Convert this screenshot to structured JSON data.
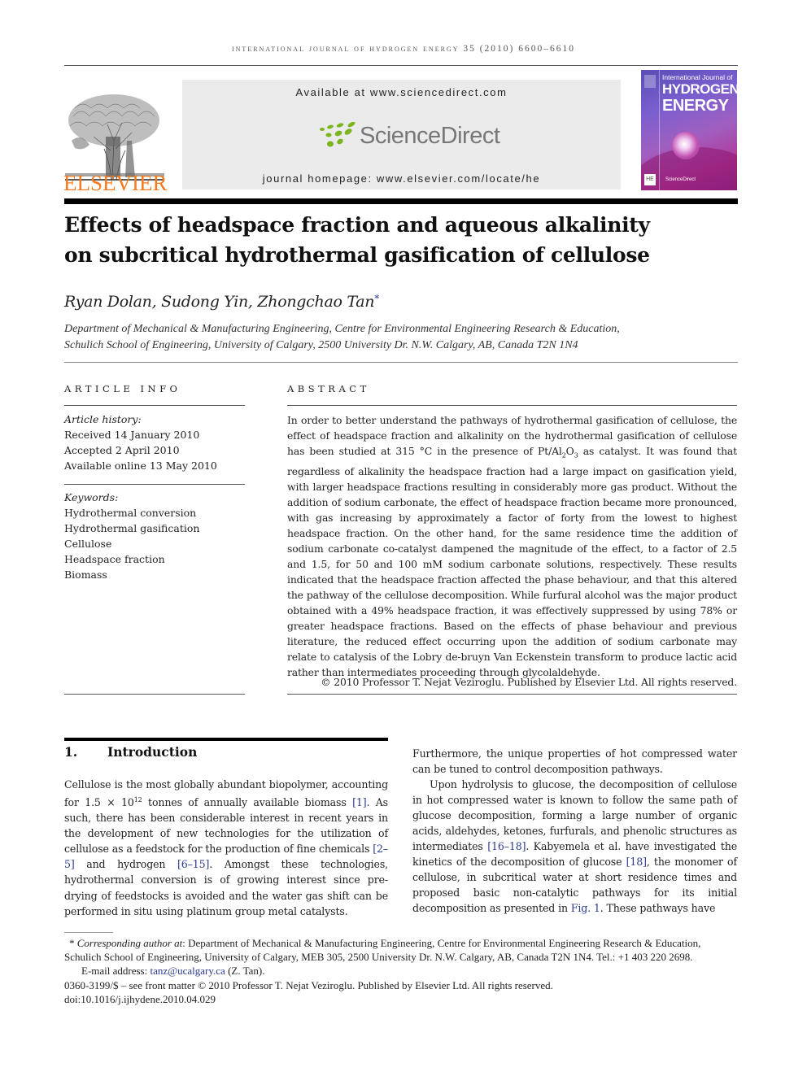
{
  "running_head": "International Journal of Hydrogen Energy 35 (2010) 6600–6610",
  "header": {
    "publisher_logo_text": "ELSEVIER",
    "available_at": "Available at www.sciencedirect.com",
    "sciencedirect_logo_text": "ScienceDirect",
    "journal_homepage": "journal homepage: www.elsevier.com/locate/he",
    "cover": {
      "line1": "International Journal of",
      "line2": "HYDROGEN",
      "line3": "ENERGY",
      "footer": "ScienceDirect",
      "badge": "HE"
    },
    "colors": {
      "elsevier_orange": "#f47b20",
      "sciencedirect_green": "#7ab51d",
      "sciencedirect_gray": "#777777",
      "box_bg": "#ebebeb",
      "link_blue": "#2b3a8f"
    }
  },
  "article": {
    "title_line1": "Effects of headspace fraction and aqueous alkalinity",
    "title_line2": "on subcritical hydrothermal gasification of cellulose",
    "authors": "Ryan Dolan, Sudong Yin, Zhongchao Tan",
    "corresponding_mark": "*",
    "affiliation_line1": "Department of Mechanical & Manufacturing Engineering, Centre for Environmental Engineering Research & Education,",
    "affiliation_line2": "Schulich School of Engineering, University of Calgary, 2500 University Dr. N.W. Calgary, AB, Canada T2N 1N4"
  },
  "article_info": {
    "heading": "ARTICLE INFO",
    "history_label": "Article history:",
    "history": [
      "Received 14 January 2010",
      "Accepted 2 April 2010",
      "Available online 13 May 2010"
    ],
    "keywords_label": "Keywords:",
    "keywords": [
      "Hydrothermal conversion",
      "Hydrothermal gasification",
      "Cellulose",
      "Headspace fraction",
      "Biomass"
    ]
  },
  "abstract": {
    "heading": "ABSTRACT",
    "text_part1": "In order to better understand the pathways of hydrothermal gasification of cellulose, the effect of headspace fraction and alkalinity on the hydrothermal gasification of cellulose has been studied at 315 °C in the presence of Pt/Al",
    "sub1": "2",
    "text_part2": "O",
    "sub2": "3",
    "text_part3": " as catalyst. It was found that regardless of alkalinity the headspace fraction had a large impact on gasification yield, with larger headspace fractions resulting in considerably more gas product. Without the addition of sodium carbonate, the effect of headspace fraction became more pronounced, with gas increasing by approximately a factor of forty from the lowest to highest headspace fraction. On the other hand, for the same residence time the addition of sodium carbonate co-catalyst dampened the magnitude of the effect, to a factor of 2.5 and 1.5, for 50 and 100 mM sodium carbonate solutions, respectively. These results indicated that the headspace fraction affected the phase behaviour, and that this altered the pathway of the cellulose decomposition. While furfural alcohol was the major product obtained with a 49% headspace fraction, it was effectively suppressed by using 78% or greater headspace fractions. Based on the effects of phase behaviour and previous literature, the reduced effect occurring upon the addition of sodium carbonate may relate to catalysis of the Lobry de-bruyn Van Eckenstein transform to produce lactic acid rather than intermediates proceeding through glycolaldehyde.",
    "copyright": "© 2010 Professor T. Nejat Veziroglu. Published by Elsevier Ltd. All rights reserved."
  },
  "introduction": {
    "number": "1.",
    "heading": "Introduction",
    "left_col": {
      "p1_a": "Cellulose is the most globally abundant biopolymer, accounting for 1.5 × 10",
      "p1_sup": "12",
      "p1_b": " tonnes of annually available biomass ",
      "ref1": "[1]",
      "p1_c": ". As such, there has been considerable interest in recent years in the development of new technologies for the utilization of cellulose as a feedstock for the production of fine chemicals ",
      "ref2": "[2–5]",
      "p1_d": " and hydrogen ",
      "ref3": "[6–15]",
      "p1_e": ". Amongst these technologies, hydrothermal conversion is of growing interest since pre-drying of feedstocks is avoided and the water gas shift can be performed in situ using platinum group metal catalysts."
    },
    "right_col": {
      "p1": "Furthermore, the unique properties of hot compressed water can be tuned to control decomposition pathways.",
      "p2_a": "Upon hydrolysis to glucose, the decomposition of cellulose in hot compressed water is known to follow the same path of glucose decomposition, forming a large number of organic acids, aldehydes, ketones, furfurals, and phenolic structures as intermediates ",
      "ref1": "[16–18]",
      "p2_b": ". Kabyemela et al. have investigated the kinetics of the decomposition of glucose ",
      "ref2": "[18]",
      "p2_c": ", the monomer of cellulose, in subcritical water at short residence times and proposed basic non-catalytic pathways for its initial decomposition as presented in ",
      "fig_ref": "Fig. 1",
      "p2_d": ". These pathways have"
    }
  },
  "footnotes": {
    "corr_mark": "*",
    "corr_label": "Corresponding author at",
    "corr_text": ": Department of Mechanical & Manufacturing Engineering, Centre for Environmental Engineering Research & Education, Schulich School of Engineering, University of Calgary, MEB 305, 2500 University Dr. N.W. Calgary, AB, Canada T2N 1N4. Tel.: +1 403 220 2698.",
    "email_label": "E-mail address: ",
    "email": "tanz@ucalgary.ca",
    "email_suffix": " (Z. Tan).",
    "front_matter": "0360-3199/$ – see front matter © 2010 Professor T. Nejat Veziroglu. Published by Elsevier Ltd. All rights reserved.",
    "doi": "doi:10.1016/j.ijhydene.2010.04.029"
  }
}
